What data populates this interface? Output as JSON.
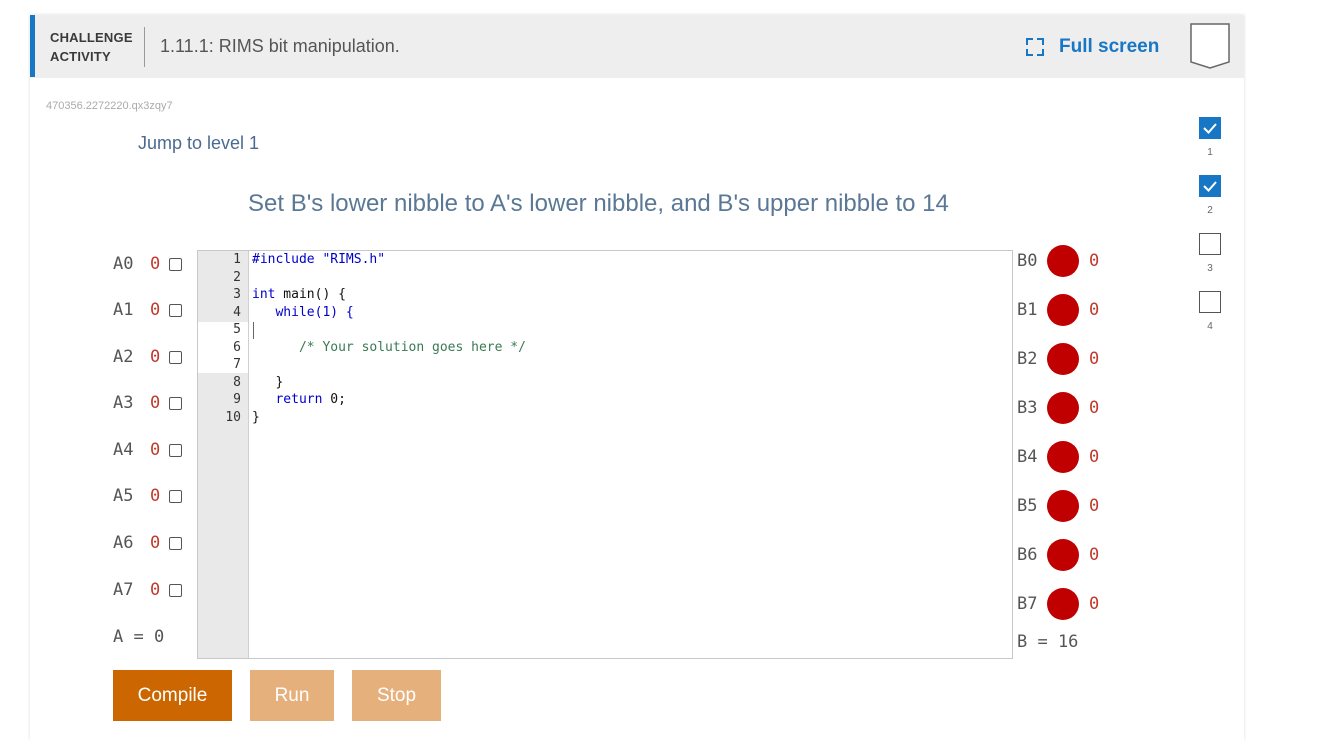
{
  "header": {
    "type_line1": "CHALLENGE",
    "type_line2": "ACTIVITY",
    "title": "1.11.1: RIMS bit manipulation.",
    "fullscreen_label": "Full screen"
  },
  "activity_id": "470356.2272220.qx3zqy7",
  "jump_label": "Jump to level 1",
  "prompt": "Set B's lower nibble to A's lower nibble, and B's upper nibble to 14",
  "inputs": [
    {
      "label": "A0",
      "value": "0"
    },
    {
      "label": "A1",
      "value": "0"
    },
    {
      "label": "A2",
      "value": "0"
    },
    {
      "label": "A3",
      "value": "0"
    },
    {
      "label": "A4",
      "value": "0"
    },
    {
      "label": "A5",
      "value": "0"
    },
    {
      "label": "A6",
      "value": "0"
    },
    {
      "label": "A7",
      "value": "0"
    }
  ],
  "a_total": "A = 0",
  "outputs": [
    {
      "label": "B0",
      "value": "0"
    },
    {
      "label": "B1",
      "value": "0"
    },
    {
      "label": "B2",
      "value": "0"
    },
    {
      "label": "B3",
      "value": "0"
    },
    {
      "label": "B4",
      "value": "0"
    },
    {
      "label": "B5",
      "value": "0"
    },
    {
      "label": "B6",
      "value": "0"
    },
    {
      "label": "B7",
      "value": "0"
    }
  ],
  "b_total": "B = 16",
  "code": {
    "line_numbers": [
      "1",
      "2",
      "3",
      "4",
      "5",
      "6",
      "7",
      "8",
      "9",
      "10"
    ],
    "l1": "#include \"RIMS.h\"",
    "l3_kw": "int",
    "l3_rest": " main() {",
    "l4_kw": "   while",
    "l4_rest": "(1) {",
    "l6": "      /* Your solution goes here */",
    "l8": "   }",
    "l9_kw": "   return",
    "l9_rest": " 0;",
    "l10": "}"
  },
  "buttons": {
    "compile": "Compile",
    "run": "Run",
    "stop": "Stop"
  },
  "levels": [
    {
      "number": "1",
      "completed": true
    },
    {
      "number": "2",
      "completed": true
    },
    {
      "number": "3",
      "completed": false
    },
    {
      "number": "4",
      "completed": false
    }
  ],
  "colors": {
    "accent": "#1877c5",
    "compile_button": "#cc6600",
    "disabled_button": "#e6b07d",
    "led_off": "#c00000"
  }
}
